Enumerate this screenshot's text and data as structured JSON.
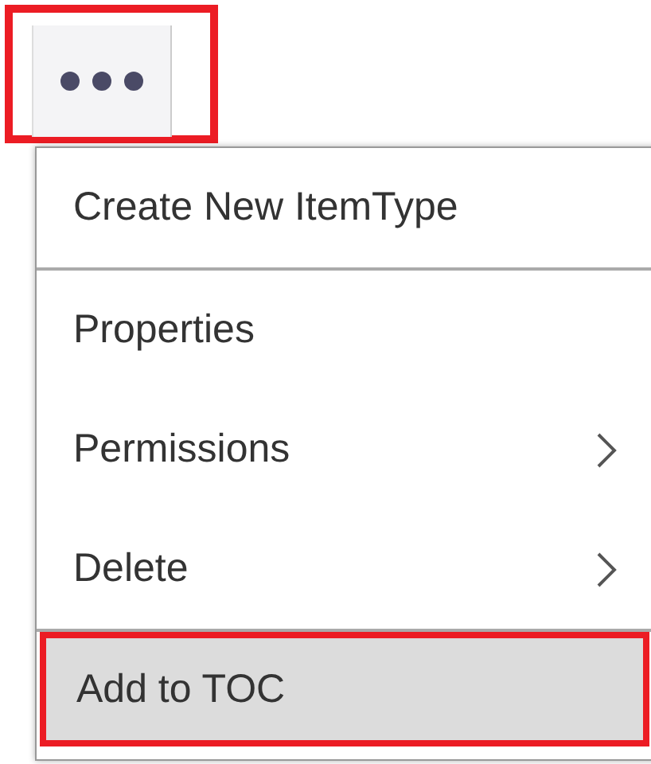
{
  "more_button": {
    "highlighted": true
  },
  "menu": {
    "items": [
      {
        "label": "Create New ItemType",
        "kind": "action",
        "divider_after": true,
        "selected": false,
        "highlighted": false
      },
      {
        "label": "Properties",
        "kind": "action",
        "divider_after": false,
        "selected": false,
        "highlighted": false
      },
      {
        "label": "Permissions",
        "kind": "submenu",
        "divider_after": false,
        "selected": false,
        "highlighted": false
      },
      {
        "label": "Delete",
        "kind": "submenu",
        "divider_after": true,
        "selected": false,
        "highlighted": false
      },
      {
        "label": "Add to TOC",
        "kind": "action",
        "divider_after": false,
        "selected": true,
        "highlighted": true
      }
    ]
  }
}
